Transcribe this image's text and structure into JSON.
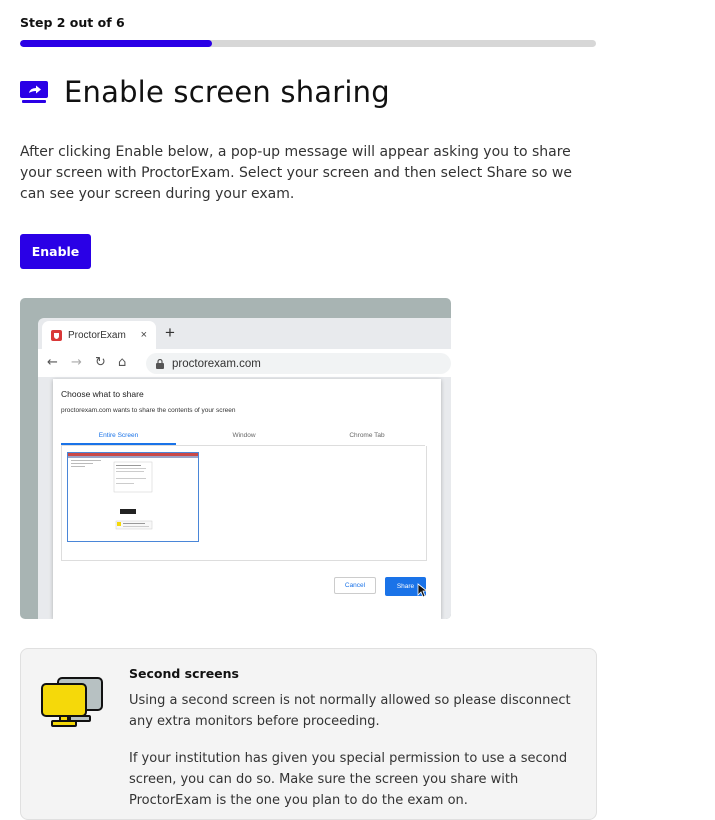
{
  "step": {
    "label": "Step 2 out of 6",
    "current": 2,
    "total": 6,
    "progress_fraction": 0.333
  },
  "heading": {
    "title": "Enable screen sharing",
    "icon": "screen-share-icon"
  },
  "description": "After clicking Enable below, a pop-up message will appear asking you to share your screen with ProctorExam. Select your screen and then select Share so we can see your screen during your exam.",
  "enable_button": "Enable",
  "illustration": {
    "tab_title": "ProctorExam",
    "tab_close": "×",
    "new_tab": "+",
    "url": "proctorexam.com",
    "dialog": {
      "title": "Choose what to share",
      "subtitle": "proctorexam.com wants to share the contents of your screen",
      "tabs": [
        "Entire Screen",
        "Window",
        "Chrome Tab"
      ],
      "cancel": "Cancel",
      "share": "Share"
    }
  },
  "info_card": {
    "icon": "second-screen-icon",
    "title": "Second screens",
    "paragraph1": "Using a second screen is not normally allowed so please disconnect any extra monitors before proceeding.",
    "paragraph2": "If your institution has given you special permission to use a second screen, you can do so. Make sure the screen you share with ProctorExam is the one you plan to do the exam on."
  },
  "colors": {
    "accent": "#2a00e6",
    "progress_track": "#d7d7d7",
    "chrome_blue": "#1a73e8",
    "monitor_yellow": "#f5d90a"
  }
}
